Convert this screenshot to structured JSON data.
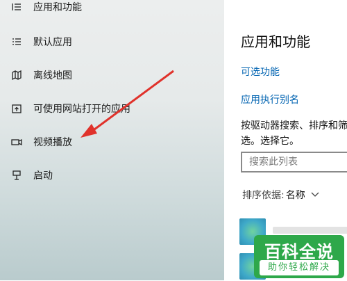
{
  "sidebar": {
    "items": [
      {
        "label": "应用和功能",
        "icon": "list-icon"
      },
      {
        "label": "默认应用",
        "icon": "default-apps-icon"
      },
      {
        "label": "离线地图",
        "icon": "map-icon"
      },
      {
        "label": "可使用网站打开的应用",
        "icon": "open-with-website-icon"
      },
      {
        "label": "视频播放",
        "icon": "video-icon"
      },
      {
        "label": "启动",
        "icon": "startup-icon"
      }
    ]
  },
  "main": {
    "title": "应用和功能",
    "links": [
      "可选功能",
      "应用执行别名"
    ],
    "description": "按驱动器搜索、排序和筛选。选择它。",
    "search": {
      "placeholder": "搜索此列表"
    },
    "sort": {
      "label": "排序依据:",
      "value": "名称"
    }
  },
  "colors": {
    "link": "#0063b1",
    "arrow": "#e0322b",
    "watermark": "#2ea84a"
  },
  "watermark": {
    "main": "百科全说",
    "sub": "助你轻松解决"
  }
}
